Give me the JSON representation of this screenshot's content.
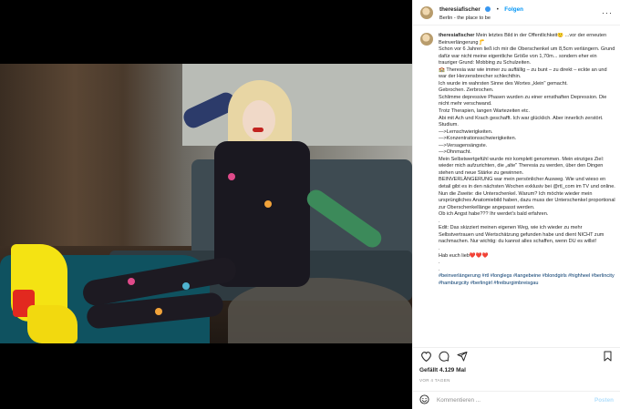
{
  "post": {
    "username": "theresiafischer",
    "follow_label": "Folgen",
    "separator": "•",
    "location": "Berlin - the place to be",
    "more_label": "···"
  },
  "caption": {
    "username": "theresiafischer",
    "text": "Mein letztes Bild in der Öffentlichkeit🙂 ...vor der erneuten Beinverlängerung🦵\nSchon vor 6 Jahren ließ ich mir die Oberschenkel um 8,5cm verlängern. Grund dafür war nicht meine eigentliche Größe von 1,70m... sondern eher ein trauriger Grund: Mobbing zu Schulzeiten.\n🏫 Theresia war wie immer zu auffällig – zu bunt – zu direkt – eckte an und war der Herzensbrecher schlechthin.\nIch wurde im wahrsten Sinne des Wortes „klein\" gemacht.\nGebrochen. Zerbrochen.\nSchlimme depressive Phasen wurden zu einer ernsthaften Depression. Die nicht mehr verschwand.\nTrotz Therapien, langen Wartezeiten etc.\nAbi mit Ach und Krach geschafft. Ich war glücklich. Aber innerlich zerstört.\nStudium.\n—>Lernschwierigkeiten.\n—>Konzentrationsschwierigkeiten.\n—>Versagensängste.\n—>Ohnmacht.\nMein Selbstwertgefühl wurde mir komplett genommen. Mein einziges Ziel: wieder mich aufzurichten, die „alte\" Theresia zu werden, über den Dingen stehen und neue Stärke zu gewinnen.\nBEINVERLÄNGERUNG war mein persönlicher Ausweg. Wie und wieso en detail gibt es in den nächsten Wochen exklusiv bei @rtl_com im TV und online.\nNun die Zweite: die Unterschenkel. Warum? Ich möchte wieder mein ursprüngliches Anatomiebild haben, dazu muss der Unterschenkel proportional zur Oberschenkellänge angepasst werden.\nOb ich Angst habe??? Ihr werdet's bald erfahren.\n.\nEdit: Das skizziert meinen eigenen Weg, wie ich wieder zu mehr Selbstvertrauen und Wertschätzung gefunden habe und dient NICHT zum nachmachen. Nur wichtig: du kannst alles schaffen, wenn DU es willst!\n.\nHab euch lieb❤️❤️❤️\n.\n.",
    "hashtags": "#beinverlängerung #rtl #longlegs #langebeine #blondgirls #highheel #berlincity #hamburgcity #berlingirl #freiburgimbreisgau"
  },
  "actions": {
    "like_icon": "heart-icon",
    "comment_icon": "comment-icon",
    "share_icon": "share-icon",
    "save_icon": "bookmark-icon"
  },
  "stats": {
    "likes": "Gefällt 4.129 Mal",
    "date": "VOR 4 TAGEN"
  },
  "comment": {
    "placeholder": "Kommentieren ...",
    "post_label": "Posten",
    "emoji_icon": "smiley-icon"
  },
  "colors": {
    "accent": "#0095f6",
    "hashtag": "#00376b",
    "muted": "#8e8e8e"
  }
}
